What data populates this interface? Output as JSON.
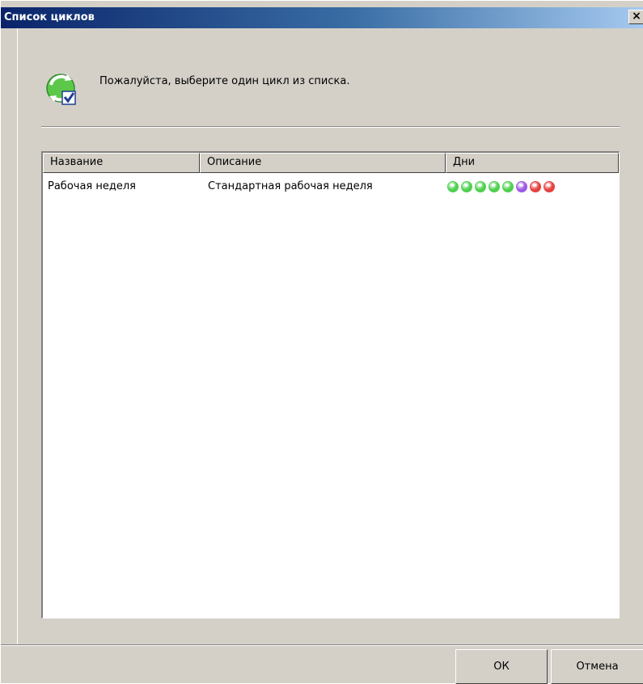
{
  "window": {
    "title": "Список циклов",
    "close_label": "✕"
  },
  "prompt": {
    "text": "Пожалуйста, выберите один цикл из списка.",
    "icon": "recycle-check-icon"
  },
  "list": {
    "columns": [
      "Название",
      "Описание",
      "Дни"
    ],
    "rows": [
      {
        "name": "Рабочая неделя",
        "description": "Стандартная рабочая неделя",
        "days": [
          "#4fd04f",
          "#4fd04f",
          "#4fd04f",
          "#4fd04f",
          "#4fd04f",
          "#9b59e6",
          "#e64040",
          "#e64040"
        ]
      }
    ]
  },
  "buttons": {
    "ok_label": "ОК",
    "cancel_label": "Отмена"
  }
}
